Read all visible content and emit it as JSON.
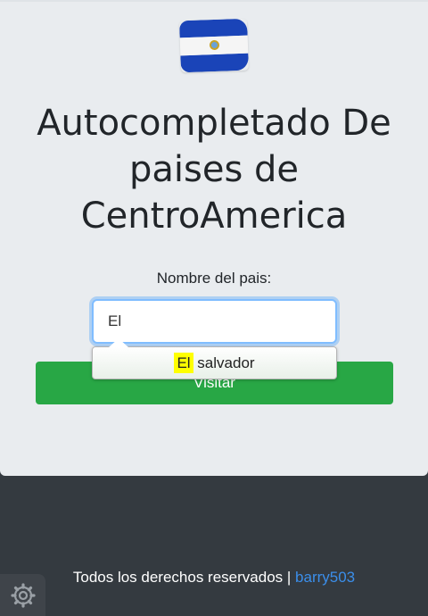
{
  "header": {
    "flag_icon": "el-salvador-flag",
    "title": "Autocompletado De paises de CentroAmerica"
  },
  "form": {
    "label": "Nombre del pais:",
    "input_value": "El",
    "visit_button": "Visitar"
  },
  "autocomplete": {
    "suggestions": [
      {
        "match": "El",
        "rest": "salvador"
      }
    ]
  },
  "footer": {
    "text": "Todos los derechos reservados |",
    "link": "barry503"
  },
  "widget": {
    "icon": "gear-icon"
  },
  "colors": {
    "button": "#28a745",
    "footer_bg": "#343a40",
    "card_bg": "#e9ecef",
    "link": "#3b8eea",
    "highlight": "#ffff00"
  }
}
